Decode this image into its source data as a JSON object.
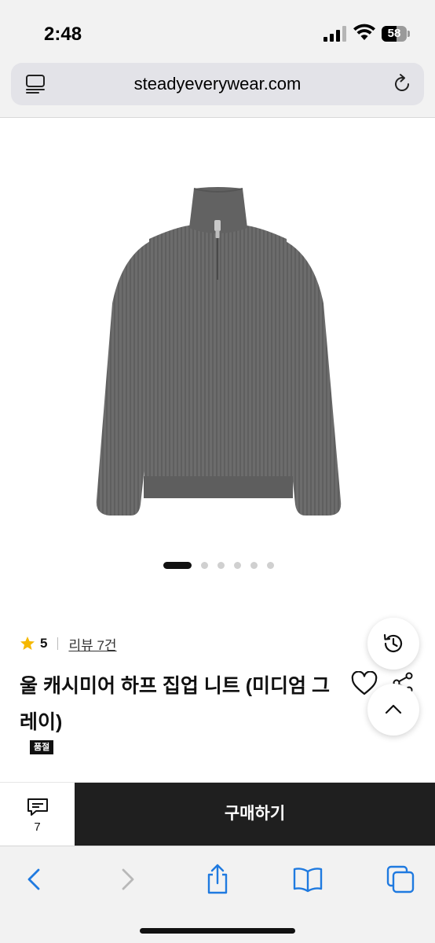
{
  "status_bar": {
    "time": "2:48",
    "battery_level": "58",
    "battery_fraction": 0.58
  },
  "browser": {
    "url": "steadyeverywear.com"
  },
  "product": {
    "image_alt": "gray ribbed half zip-up knit sweater",
    "carousel_total": 6,
    "carousel_active_index": 0,
    "rating_value": "5",
    "review_link": "리뷰 7건",
    "title": "울 캐시미어 하프 집업 니트 (미디엄 그레이)",
    "status_badge": "품절"
  },
  "purchase_bar": {
    "review_count": "7",
    "buy_label": "구매하기"
  },
  "colors": {
    "accent_star": "#f5b800",
    "buy_button_bg": "#1f1f1f",
    "link_blue": "#1f7ae0"
  },
  "icons": {
    "reader": "reader-mode-icon",
    "reload": "reload-icon",
    "star": "star-icon",
    "heart": "heart-icon",
    "share": "share-icon",
    "history": "history-icon",
    "scroll_top": "chevron-up-icon",
    "comment": "comment-icon",
    "back": "chevron-left-icon",
    "forward": "chevron-right-icon",
    "share_sheet": "share-sheet-icon",
    "bookmarks": "book-icon",
    "tabs": "tabs-icon"
  }
}
